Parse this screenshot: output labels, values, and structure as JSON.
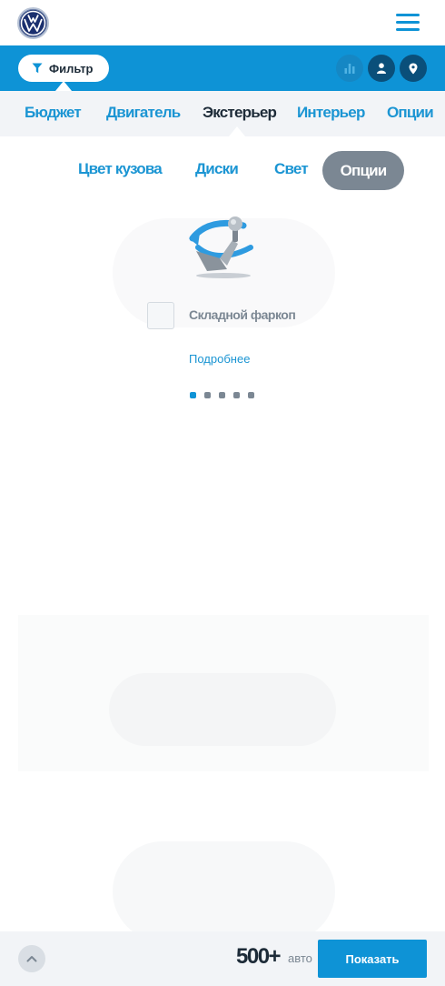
{
  "header": {
    "logo_icon": "volkswagen-logo",
    "menu_icon": "hamburger-menu-icon"
  },
  "filterbar": {
    "filter_label": "Фильтр",
    "filter_icon": "funnel-icon",
    "action_icons": [
      "bar-chart-icon",
      "user-icon",
      "map-pin-icon"
    ]
  },
  "categories": {
    "items": [
      "Бюджет",
      "Двигатель",
      "Экстерьер",
      "Интерьер",
      "Опции"
    ],
    "active": "Экстерьер"
  },
  "subtabs": {
    "items": [
      "Цвет кузова",
      "Диски",
      "Свет",
      "Опции"
    ],
    "active": "Опции"
  },
  "option": {
    "image_icon": "tow-hitch-icon",
    "label": "Складной фаркоп",
    "checked": false,
    "more_link": "Подробнее"
  },
  "carousel": {
    "pages": 5,
    "active_index": 0
  },
  "footer": {
    "scroll_icon": "chevron-up-icon",
    "count": "500+",
    "count_unit": "авто",
    "show_button": "Показать"
  },
  "colors": {
    "brand_blue": "#0e93d6",
    "dark_blue": "#0a4f7a",
    "text_dark": "#1d2b38",
    "muted_gray": "#7b8793",
    "tab_bg": "#f2f4f7"
  }
}
